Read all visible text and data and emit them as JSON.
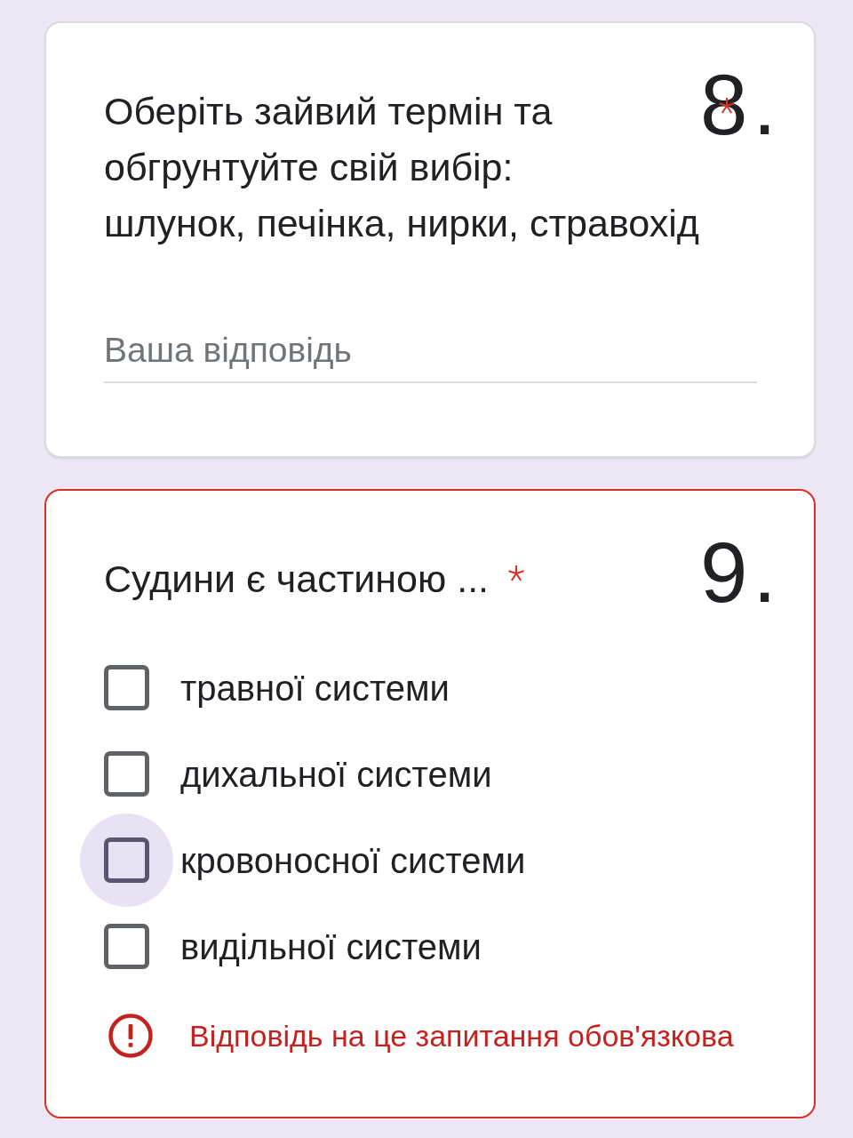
{
  "questions": [
    {
      "kind": "text",
      "number": "8.",
      "title": "Оберіть зайвий термін та\nобгрунтуйте свій вибір:\nшлунок, печінка, нирки, стравохід",
      "required": true,
      "error": false,
      "answer": {
        "placeholder": "Ваша відповідь"
      }
    },
    {
      "kind": "checkbox",
      "number": "9.",
      "title": "Судини є частиною ...",
      "required": true,
      "error": true,
      "options": [
        {
          "label": "травної системи",
          "checked": false,
          "focused": false
        },
        {
          "label": "дихальної системи",
          "checked": false,
          "focused": false
        },
        {
          "label": "кровоносної системи",
          "checked": false,
          "focused": true
        },
        {
          "label": "видільної системи",
          "checked": false,
          "focused": false
        }
      ],
      "error_message": "Відповідь на це запитання обов'язкова"
    }
  ]
}
